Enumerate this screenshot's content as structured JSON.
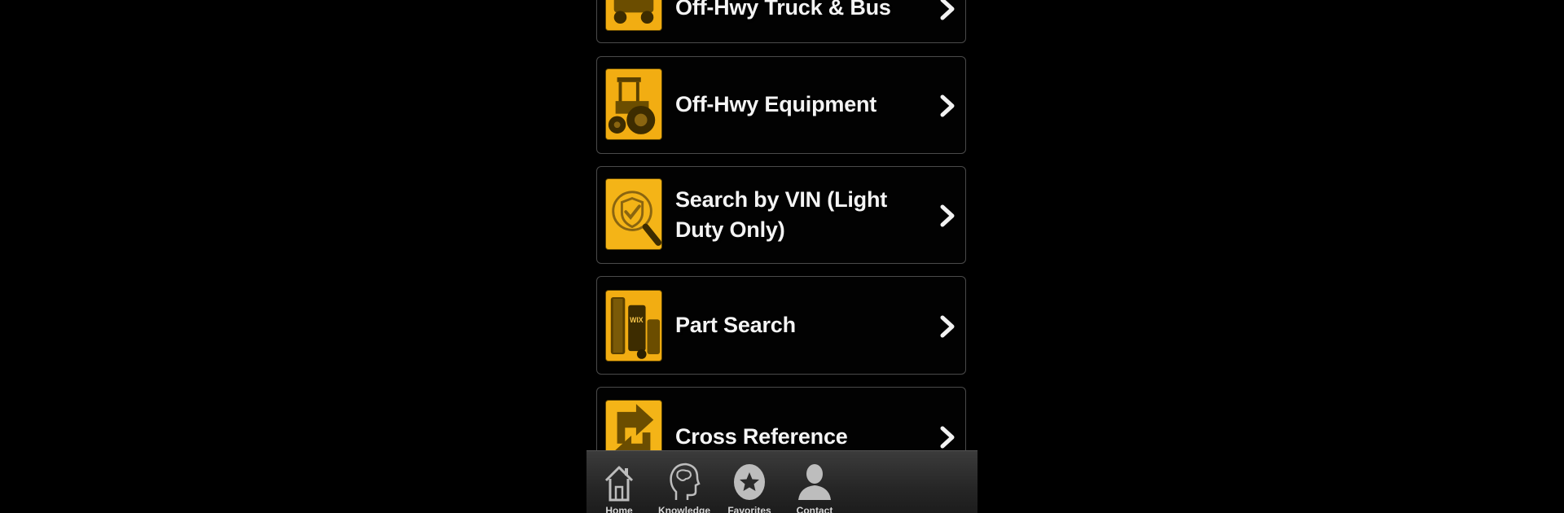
{
  "menu": {
    "items": [
      {
        "label": "Off-Hwy Truck & Bus",
        "icon": "truck-icon"
      },
      {
        "label": "Off-Hwy Equipment",
        "icon": "tractor-icon"
      },
      {
        "label": "Search by VIN (Light Duty Only)",
        "icon": "vin-search-icon"
      },
      {
        "label": "Part Search",
        "icon": "filters-icon"
      },
      {
        "label": "Cross Reference",
        "icon": "cross-reference-arrow-icon"
      }
    ]
  },
  "tabbar": {
    "tabs": [
      {
        "label": "Home",
        "icon": "home-icon"
      },
      {
        "label": "Knowledge",
        "icon": "head-icon"
      },
      {
        "label": "Favorites",
        "icon": "star-icon"
      },
      {
        "label": "Contact",
        "icon": "person-icon"
      }
    ]
  },
  "colors": {
    "background": "#000000",
    "accent": "#f7b81c",
    "text": "#f4f4f4"
  }
}
